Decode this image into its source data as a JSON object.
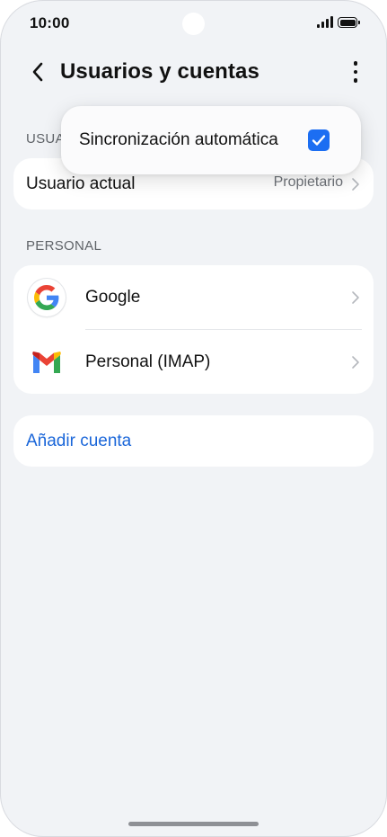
{
  "status_bar": {
    "time": "10:00"
  },
  "header": {
    "back_icon": "chevron-left-icon",
    "title": "Usuarios y cuentas",
    "more_icon": "more-vertical-icon"
  },
  "users_section": {
    "label": "USUA",
    "current_user": {
      "label": "Usuario actual",
      "value": "Propietario"
    }
  },
  "personal_section": {
    "label": "PERSONAL",
    "accounts": [
      {
        "label": "Google",
        "icon": "google-icon"
      },
      {
        "label": "Personal (IMAP)",
        "icon": "gmail-icon"
      }
    ]
  },
  "add_account": {
    "label": "Añadir cuenta"
  },
  "popup_menu": {
    "auto_sync_label": "Sincronización automática",
    "auto_sync_checked": true
  },
  "colors": {
    "accent": "#1C6EF2",
    "link": "#1A66D9",
    "background": "#F1F3F6"
  }
}
